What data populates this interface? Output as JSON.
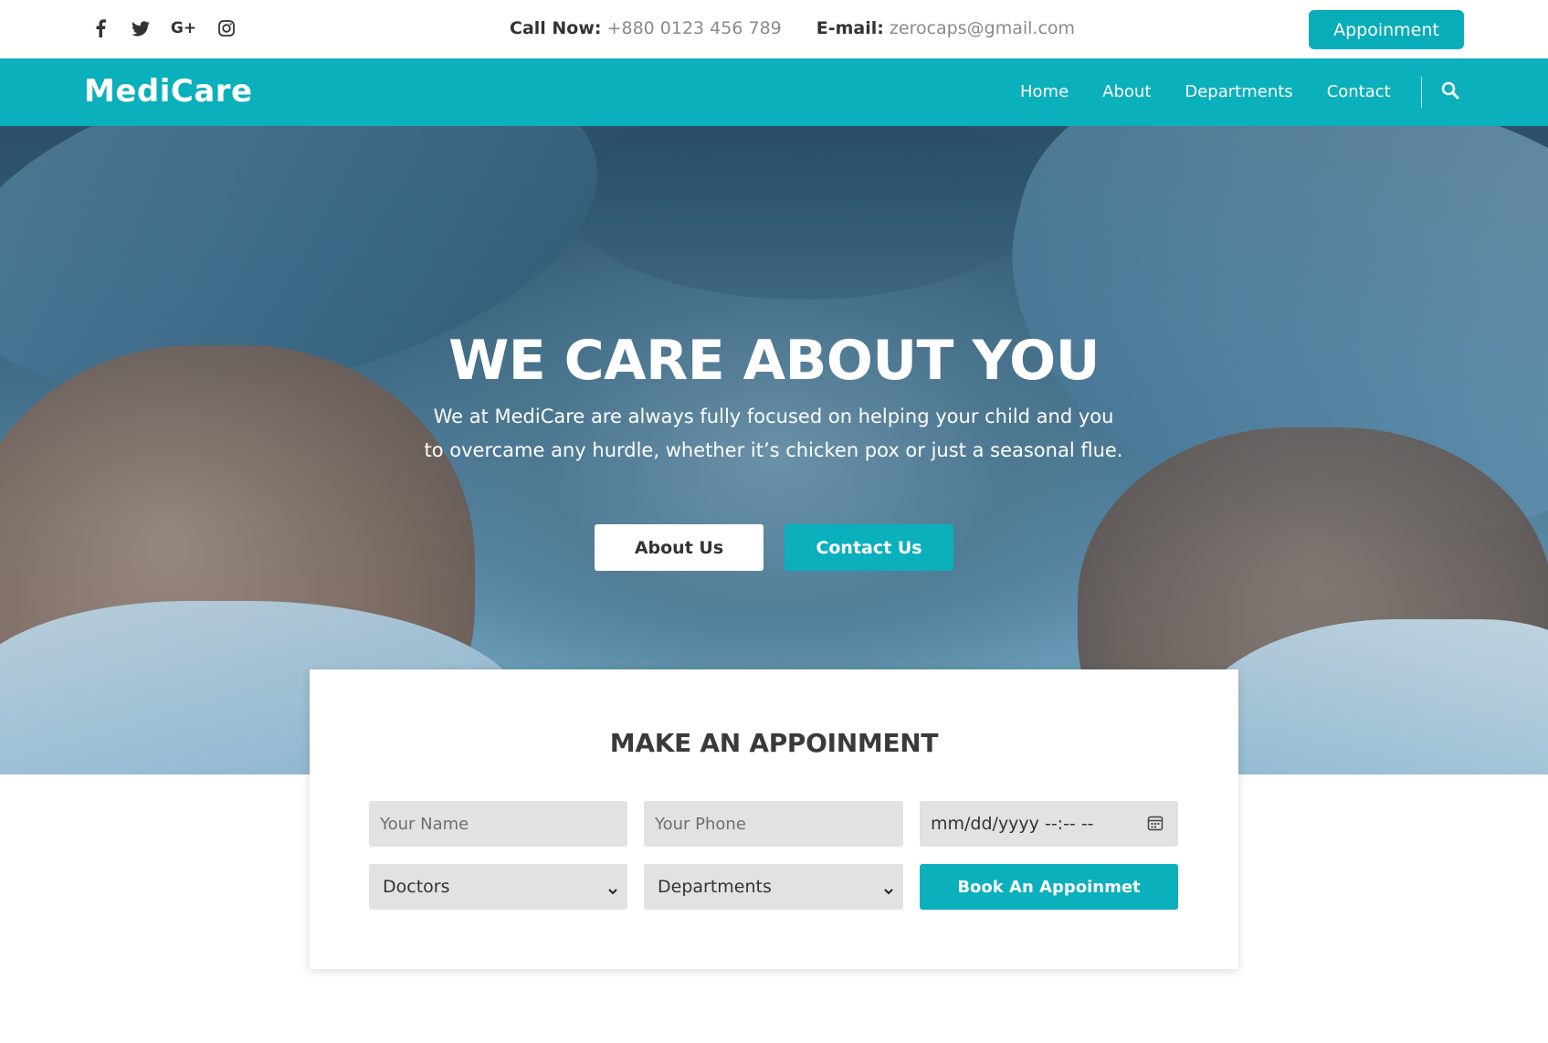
{
  "topbar": {
    "socials": [
      {
        "icon": "facebook-icon",
        "glyph": "f"
      },
      {
        "icon": "twitter-icon",
        "glyph": "t"
      },
      {
        "icon": "google-plus-icon",
        "glyph": "G+"
      },
      {
        "icon": "instagram-icon",
        "glyph": "◎"
      }
    ],
    "call_label": "Call Now:",
    "call_value": "+880 0123 456 789",
    "email_label": "E-mail:",
    "email_value": "zerocaps@gmail.com",
    "appointment_button": "Appoinment"
  },
  "navbar": {
    "brand": "MediCare",
    "links": [
      "Home",
      "About",
      "Departments",
      "Contact"
    ],
    "search_icon": "search-icon"
  },
  "hero": {
    "title": "WE CARE ABOUT YOU",
    "subtitle_line1": "We at MediCare are always fully focused on helping your child and you",
    "subtitle_line2": "to overcame any hurdle, whether it’s chicken pox or just a seasonal flue.",
    "about_button": "About Us",
    "contact_button": "Contact Us"
  },
  "appointment": {
    "title": "MAKE AN APPOINMENT",
    "name_placeholder": "Your Name",
    "phone_placeholder": "Your Phone",
    "date_placeholder": "mm/dd/yyyy --:-- --",
    "doctors_select": "Doctors",
    "departments_select": "Departments",
    "book_button": "Book An Appoinmet"
  },
  "colors": {
    "accent": "#0ab0bb",
    "text_dark": "#333333",
    "field_bg": "#e2e2e2"
  }
}
